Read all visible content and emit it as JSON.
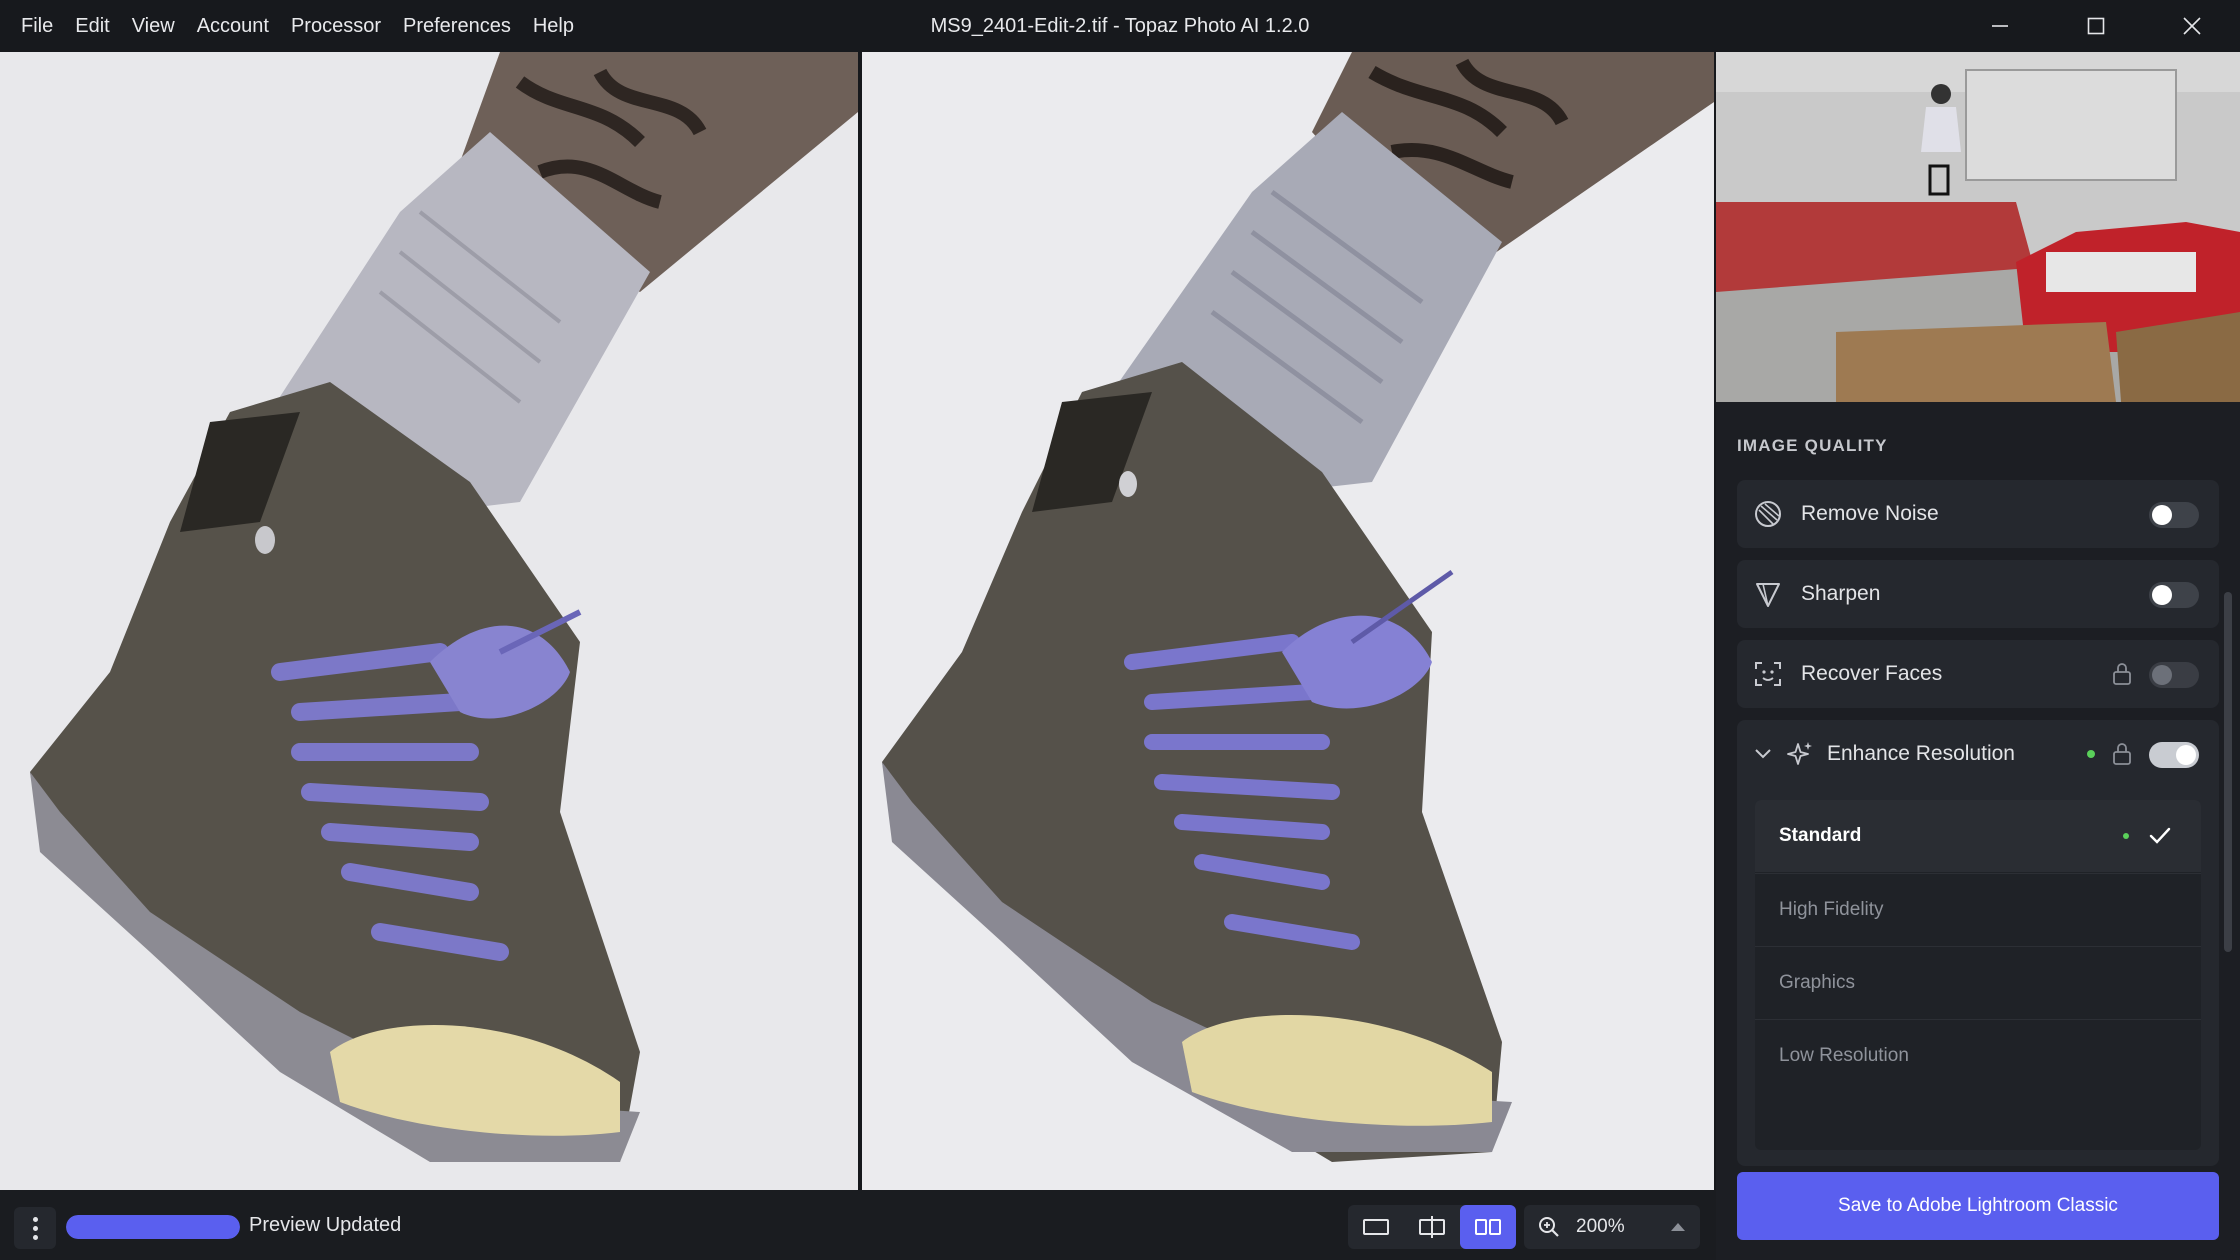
{
  "menu": {
    "items": [
      "File",
      "Edit",
      "View",
      "Account",
      "Processor",
      "Preferences",
      "Help"
    ]
  },
  "window": {
    "title": "MS9_2401-Edit-2.tif - Topaz Photo AI 1.2.0"
  },
  "sidebar": {
    "section_title": "IMAGE QUALITY",
    "tools": [
      {
        "label": "Remove Noise",
        "icon": "noise-icon",
        "enabled": false,
        "locked": false
      },
      {
        "label": "Sharpen",
        "icon": "sharpen-icon",
        "enabled": false,
        "locked": false
      },
      {
        "label": "Recover Faces",
        "icon": "face-scan-icon",
        "enabled": false,
        "locked": true
      },
      {
        "label": "Enhance Resolution",
        "icon": "sparkle-icon",
        "enabled": true,
        "locked": true,
        "expanded": true
      }
    ],
    "models": [
      {
        "label": "Standard",
        "selected": true
      },
      {
        "label": "High Fidelity",
        "selected": false
      },
      {
        "label": "Graphics",
        "selected": false
      },
      {
        "label": "Low Resolution",
        "selected": false
      }
    ],
    "save_label": "Save to Adobe Lightroom Classic"
  },
  "bottombar": {
    "status": "Preview Updated",
    "progress": 1.0,
    "zoom": "200%",
    "view_modes": [
      "single-view-icon",
      "split-view-icon",
      "side-by-side-view-icon"
    ],
    "active_view": 2
  },
  "colors": {
    "accent": "#5a5fef",
    "status_dot": "#5ad05a",
    "background": "#16181c",
    "card": "#25282e"
  }
}
